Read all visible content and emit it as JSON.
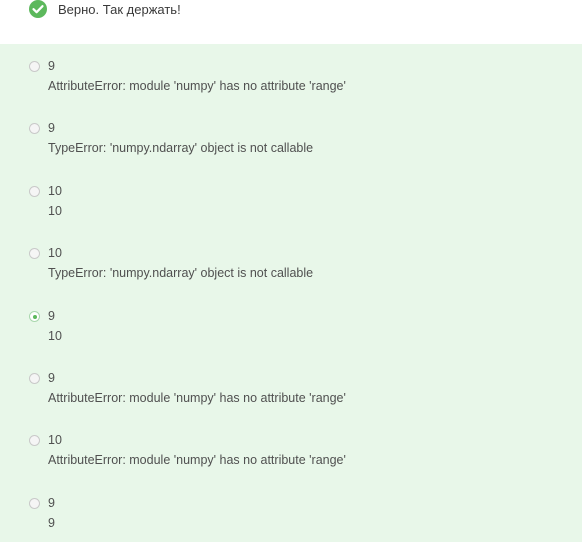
{
  "feedback": {
    "text": "Верно. Так держать!"
  },
  "colors": {
    "success": "#5cb85c",
    "options_background": "#e8f7e9"
  },
  "options": [
    {
      "line1": "9",
      "line2": "AttributeError: module 'numpy' has no attribute 'range'",
      "selected": false
    },
    {
      "line1": "9",
      "line2": "TypeError: 'numpy.ndarray' object is not callable",
      "selected": false
    },
    {
      "line1": "10",
      "line2": "10",
      "selected": false
    },
    {
      "line1": "10",
      "line2": "TypeError: 'numpy.ndarray' object is not callable",
      "selected": false
    },
    {
      "line1": "9",
      "line2": "10",
      "selected": true
    },
    {
      "line1": "9",
      "line2": "AttributeError: module 'numpy' has no attribute 'range'",
      "selected": false
    },
    {
      "line1": "10",
      "line2": "AttributeError: module 'numpy' has no attribute 'range'",
      "selected": false
    },
    {
      "line1": "9",
      "line2": "9",
      "selected": false
    }
  ]
}
